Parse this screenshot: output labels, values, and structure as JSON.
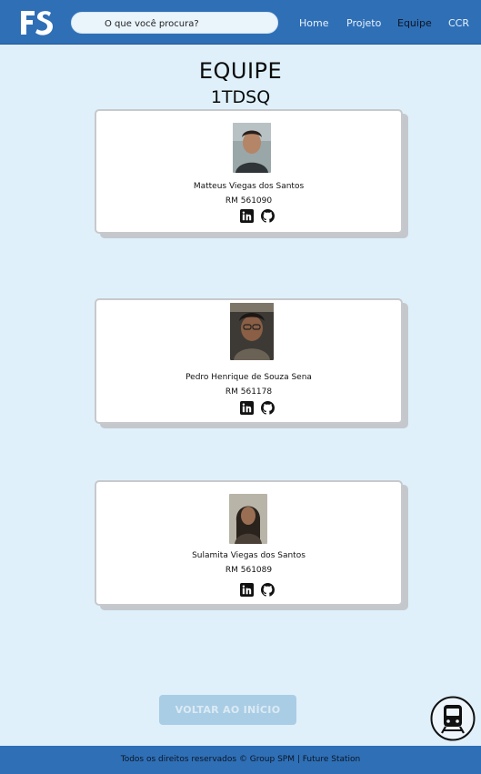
{
  "header": {
    "logo_text": "FS",
    "search": {
      "placeholder": "O que você procura?",
      "value": ""
    },
    "nav": [
      {
        "label": "Home",
        "active": false
      },
      {
        "label": "Projeto",
        "active": false
      },
      {
        "label": "Equipe",
        "active": true
      },
      {
        "label": "CCR",
        "active": false
      }
    ]
  },
  "page": {
    "title": "EQUIPE",
    "subtitle": "1TDSQ"
  },
  "members": [
    {
      "name": "Matteus Viegas dos Santos",
      "rm": "RM 561090"
    },
    {
      "name": "Pedro Henrique de Souza Sena",
      "rm": "RM 561178"
    },
    {
      "name": "Sulamita Viegas dos Santos",
      "rm": "RM 561089"
    }
  ],
  "icons": {
    "linkedin": "linkedin-icon",
    "github": "github-icon",
    "train": "train-icon"
  },
  "back_button": {
    "label": "VOLTAR AO INÍCIO"
  },
  "footer": {
    "text": "Todos os direitos reservados © Group SPM | Future Station"
  },
  "colors": {
    "header": "#2f6fb6",
    "background": "#dff0fa",
    "button": "#a9cde5"
  }
}
